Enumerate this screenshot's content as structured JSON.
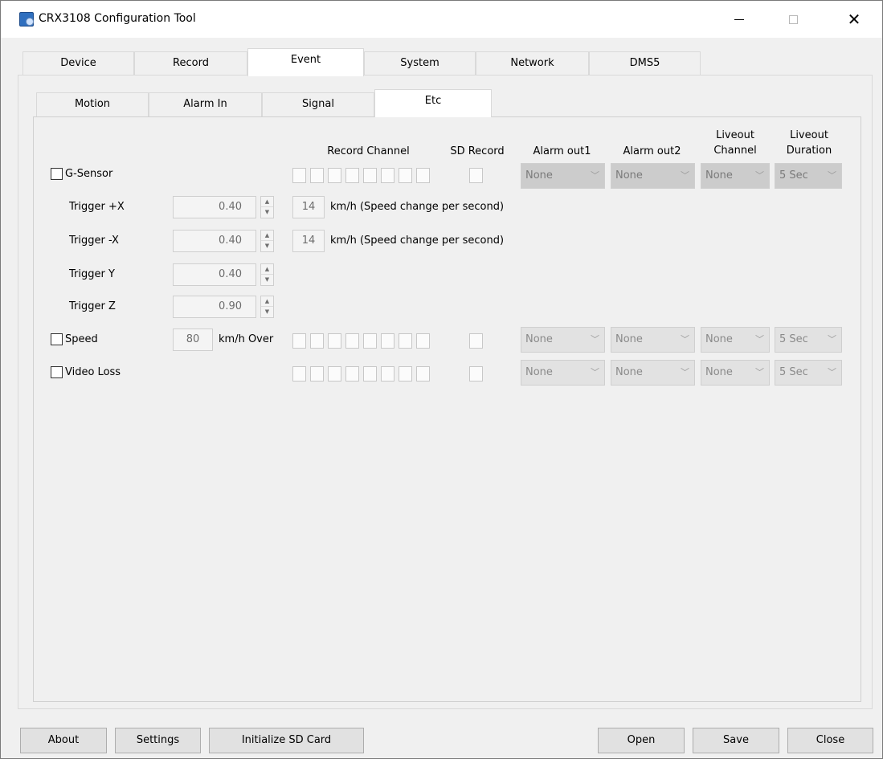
{
  "window": {
    "title": "CRX3108 Configuration Tool"
  },
  "main_tabs": [
    "Device",
    "Record",
    "Event",
    "System",
    "Network",
    "DMS5"
  ],
  "sub_tabs": [
    "Motion",
    "Alarm In",
    "Signal",
    "Etc"
  ],
  "columns": {
    "record_channel": "Record Channel",
    "sd_record": "SD Record",
    "alarm_out1": "Alarm out1",
    "alarm_out2": "Alarm out2",
    "liveout_channel": "Liveout Channel",
    "liveout_duration": "Liveout Duration"
  },
  "gsensor": {
    "label": "G-Sensor",
    "checked": false,
    "alarm_out1": "None",
    "alarm_out2": "None",
    "liveout_channel": "None",
    "liveout_duration": "5 Sec",
    "triggers": [
      {
        "label": "Trigger +X",
        "value": "0.40",
        "speed": "14",
        "unit": "km/h (Speed change per second)"
      },
      {
        "label": "Trigger -X",
        "value": "0.40",
        "speed": "14",
        "unit": "km/h (Speed change per second)"
      },
      {
        "label": "Trigger Y",
        "value": "0.40"
      },
      {
        "label": "Trigger Z",
        "value": "0.90"
      }
    ]
  },
  "speed": {
    "label": "Speed",
    "checked": false,
    "value": "80",
    "unit": "km/h Over",
    "alarm_out1": "None",
    "alarm_out2": "None",
    "liveout_channel": "None",
    "liveout_duration": "5 Sec"
  },
  "video_loss": {
    "label": "Video Loss",
    "checked": false,
    "alarm_out1": "None",
    "alarm_out2": "None",
    "liveout_channel": "None",
    "liveout_duration": "5 Sec"
  },
  "footer": {
    "about": "About",
    "settings": "Settings",
    "init_sd": "Initialize SD Card",
    "open": "Open",
    "save": "Save",
    "close": "Close"
  }
}
